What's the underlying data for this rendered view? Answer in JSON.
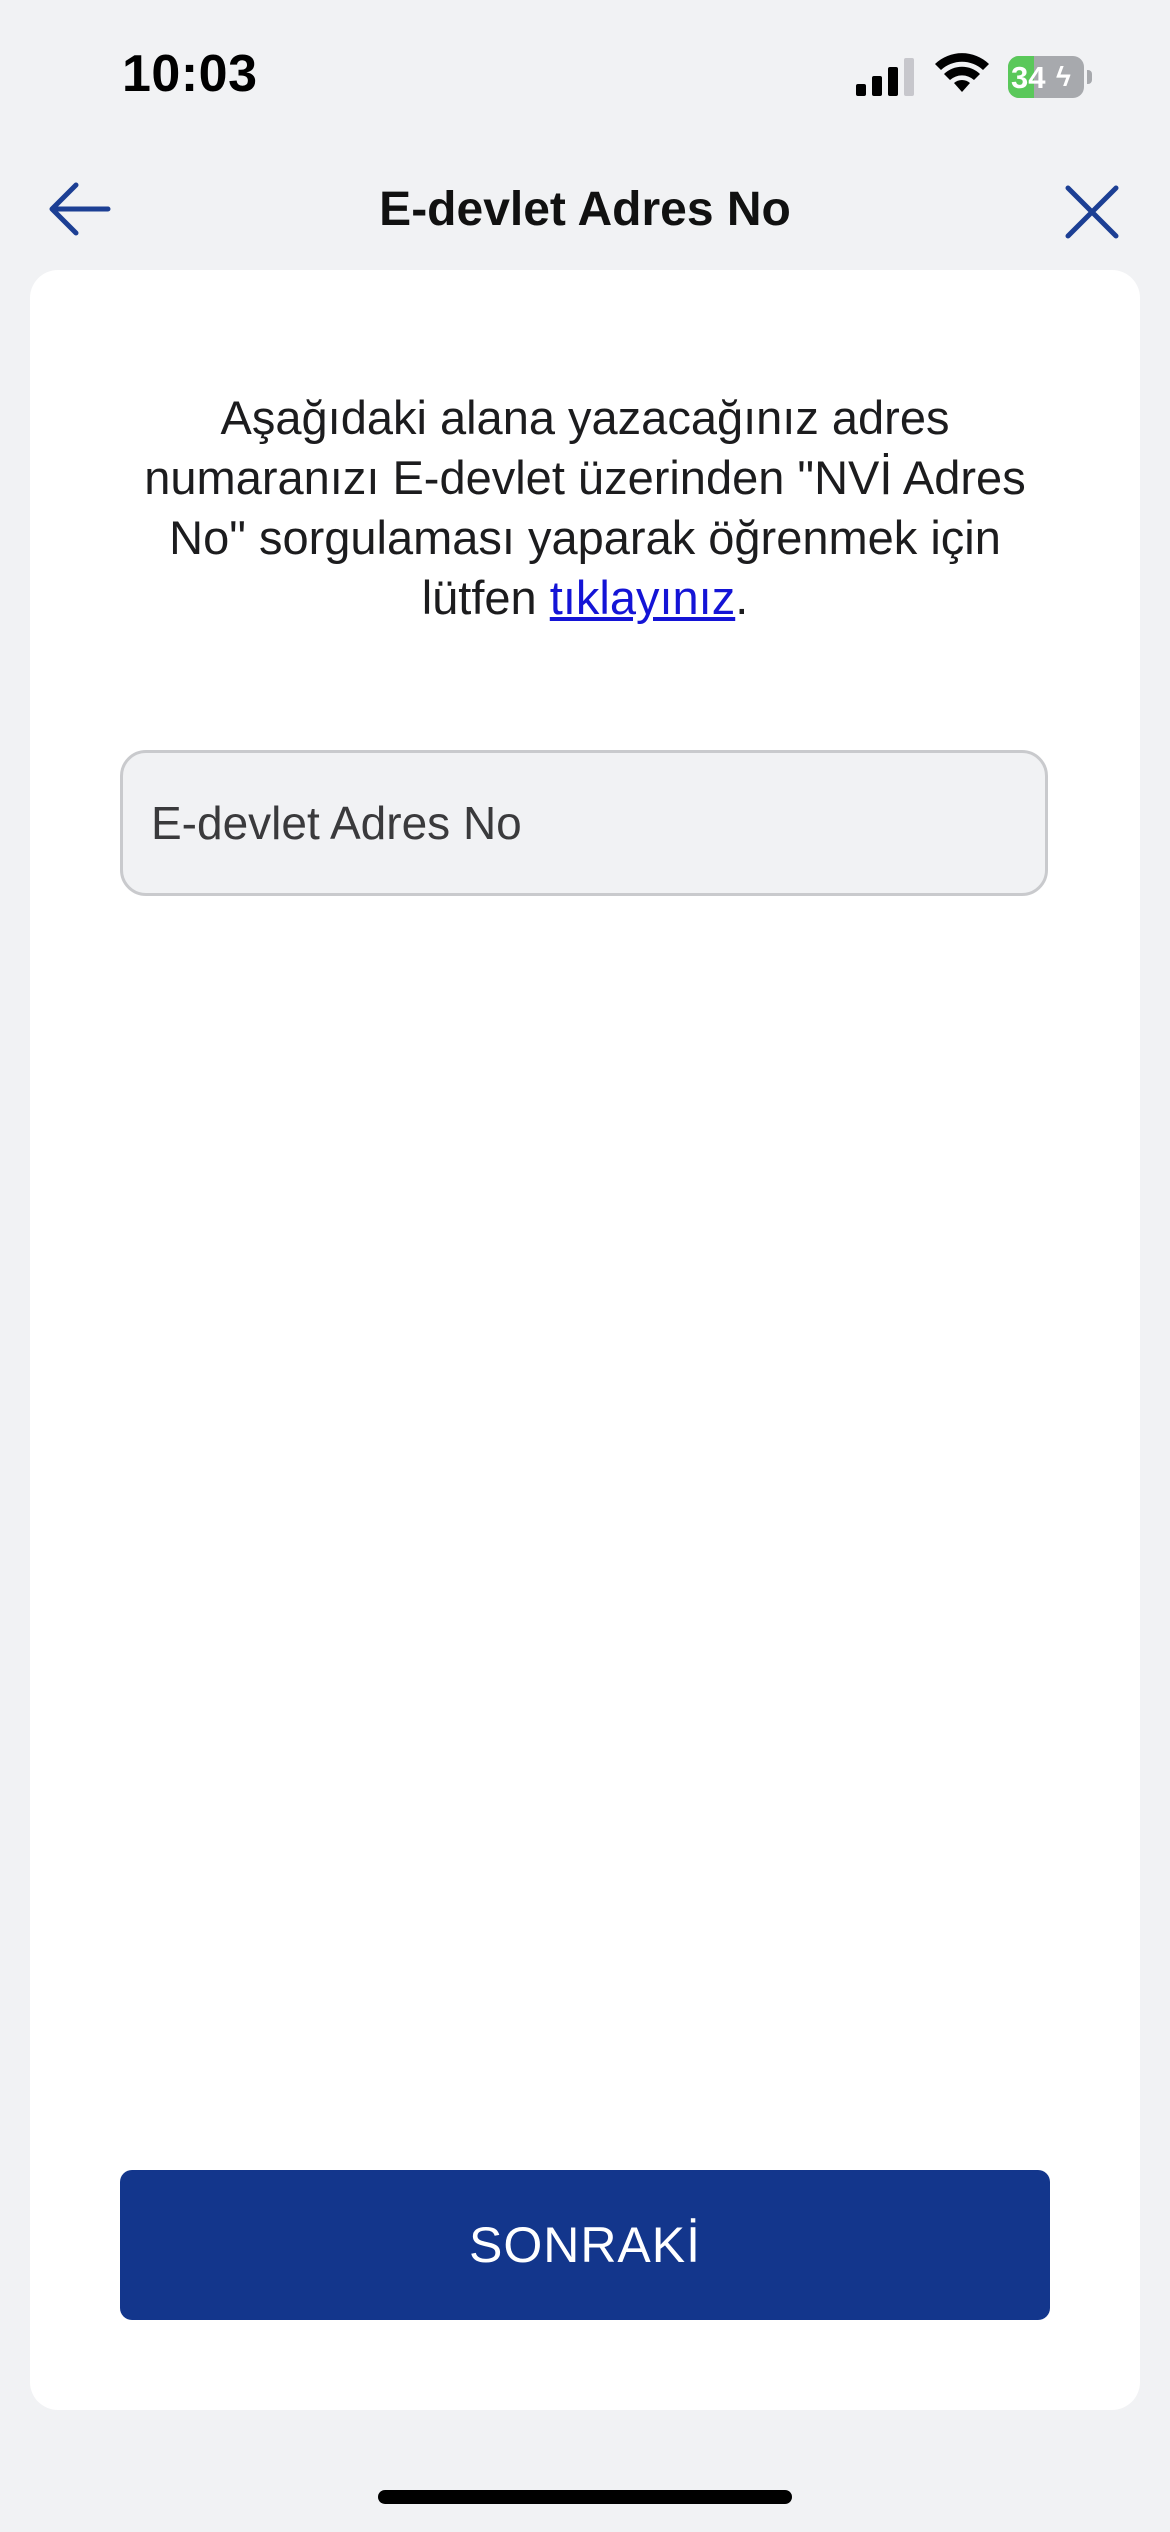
{
  "status_bar": {
    "time": "10:03",
    "battery_percent": "34",
    "battery_level": 0.34,
    "icons": [
      "signal-icon",
      "wifi-icon",
      "battery-icon",
      "charging-bolt-icon"
    ]
  },
  "nav": {
    "title": "E-devlet Adres No",
    "back_icon": "arrow-left-icon",
    "close_icon": "close-icon"
  },
  "info": {
    "text_before_link": "Aşağıdaki alana yazacağınız adres numaranızı E-devlet üzerinden \"NVİ Adres No\" sorgulaması yaparak öğrenmek için lütfen ",
    "link_text": "tıklayınız",
    "text_after_link": "."
  },
  "address_field": {
    "placeholder": "E-devlet Adres No",
    "value": ""
  },
  "footer": {
    "next_label": "SONRAKİ"
  },
  "colors": {
    "background": "#f1f2f4",
    "card": "#ffffff",
    "primary_button": "#13368c",
    "nav_icon": "#1c3f94",
    "link": "#1414d6",
    "battery_fill": "#5ac85a"
  }
}
